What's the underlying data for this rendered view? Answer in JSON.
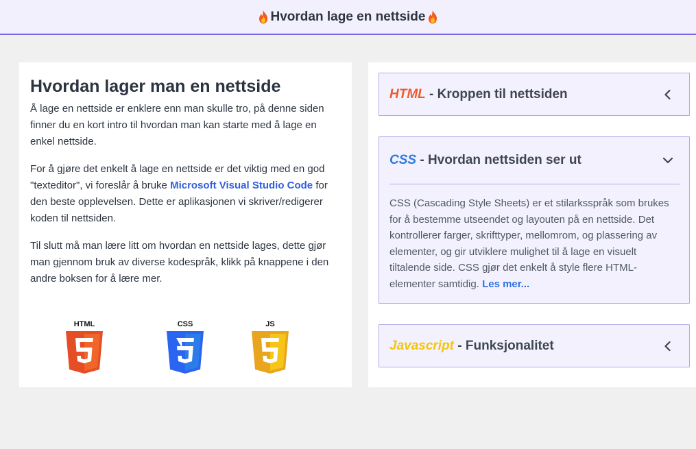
{
  "header": {
    "title": "Hvordan lage en nettside",
    "icon": "fire-icon"
  },
  "intro": {
    "title": "Hvordan lager man en nettside",
    "p1": "Å lage en nettside er enklere enn man skulle tro, på denne siden finner du en kort intro til hvordan man kan starte med å lage en enkel nettside.",
    "p2_before": "For å gjøre det enkelt å lage en nettside er det viktig med en god \"texteditor\", vi foreslår å bruke ",
    "p2_link": "Microsoft Visual Studio Code",
    "p2_after": " for den beste opplevelsen. Dette er aplikasjonen vi skriver/redigerer koden til nettsiden.",
    "p3": "Til slutt må man lære litt om hvordan en nettside lages, dette gjør man gjennom bruk av diverse kodespråk, klikk på knappene i den andre boksen for å lære mer.",
    "logos": [
      {
        "label": "HTML",
        "digit": "5",
        "color": "#e44d26",
        "icon": "html5-logo"
      },
      {
        "label": "CSS",
        "digit": "3",
        "color": "#2965f1",
        "icon": "css3-logo"
      },
      {
        "label": "JS",
        "digit": "5",
        "color": "#e9a51e",
        "icon": "js-logo"
      }
    ]
  },
  "accordion": {
    "items": [
      {
        "keyword": "HTML",
        "rest": " - Kroppen til nettsiden",
        "state": "collapsed",
        "icon": "chevron-left-icon"
      },
      {
        "keyword": "CSS",
        "rest": " - Hvordan nettsiden ser ut",
        "state": "expanded",
        "icon": "chevron-down-icon",
        "body": "CSS (Cascading Style Sheets) er et stilarksspråk som brukes for å bestemme utseendet og layouten på en nettside. Det kontrollerer farger, skrifttyper, mellomrom, og plassering av elementer, og gir utviklere mulighet til å lage en visuelt tiltalende side. CSS gjør det enkelt å style flere HTML-elementer samtidig. ",
        "link": "Les mer..."
      },
      {
        "keyword": "Javascript",
        "rest": " - Funksjonalitet",
        "state": "collapsed",
        "icon": "chevron-left-icon"
      }
    ]
  },
  "colors": {
    "accent": "#7868e6",
    "html": "#f05a28",
    "css": "#2f7be0",
    "js": "#f2c60e",
    "link": "#2f5fe0"
  }
}
